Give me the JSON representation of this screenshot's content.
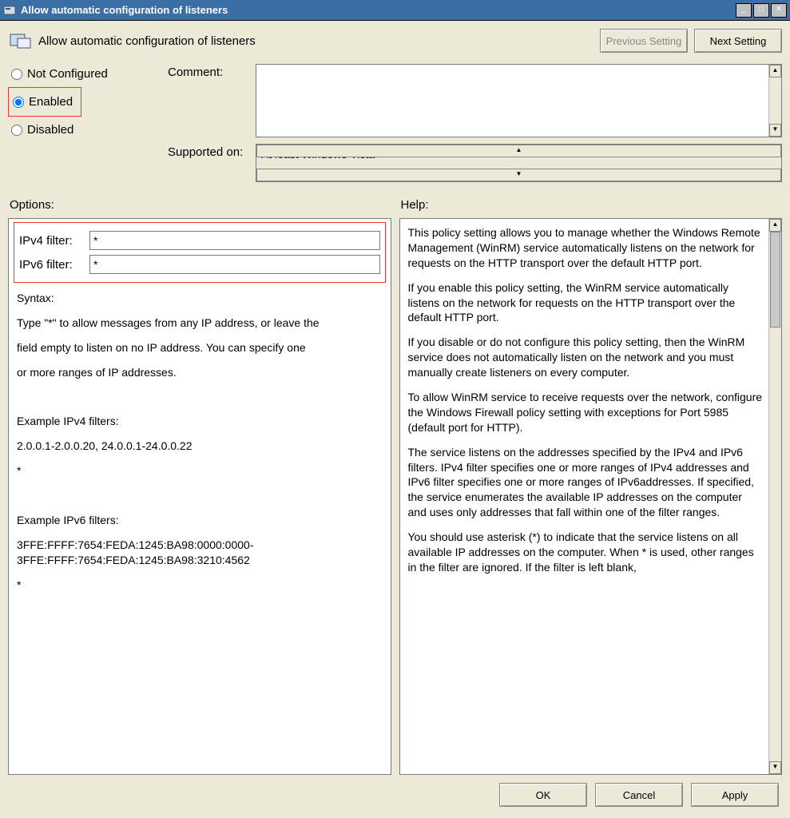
{
  "window": {
    "title": "Allow automatic configuration of listeners"
  },
  "header": {
    "title": "Allow automatic configuration of listeners"
  },
  "nav": {
    "prev": "Previous Setting",
    "next": "Next Setting"
  },
  "radios": {
    "not_configured": "Not Configured",
    "enabled": "Enabled",
    "disabled": "Disabled",
    "selected": "enabled"
  },
  "comment": {
    "label": "Comment:",
    "value": ""
  },
  "supported": {
    "label": "Supported on:",
    "value": "At least Windows Vista"
  },
  "options": {
    "header": "Options:",
    "ipv4_label": "IPv4 filter:",
    "ipv4_value": "*",
    "ipv6_label": "IPv6 filter:",
    "ipv6_value": "*",
    "syntax_head": "Syntax:",
    "syntax_l1": "Type \"*\" to allow messages from any IP address, or leave the",
    "syntax_l2": "field empty to listen on no IP address. You can specify one",
    "syntax_l3": "or more ranges of IP addresses.",
    "ex4_head": "Example IPv4 filters:",
    "ex4_l1": "2.0.0.1-2.0.0.20, 24.0.0.1-24.0.0.22",
    "ex4_l2": "*",
    "ex6_head": "Example IPv6 filters:",
    "ex6_l1": "3FFE:FFFF:7654:FEDA:1245:BA98:0000:0000-3FFE:FFFF:7654:FEDA:1245:BA98:3210:4562",
    "ex6_l2": "*"
  },
  "help": {
    "header": "Help:",
    "p1": "This policy setting allows you to manage whether the Windows Remote Management (WinRM) service automatically listens on the network for requests on the HTTP transport over the default HTTP port.",
    "p2": "If you enable this policy setting, the WinRM service automatically listens on the network for requests on the HTTP transport over the default HTTP port.",
    "p3": "If you disable or do not configure this policy setting, then the WinRM service does not automatically listen on the network and you must manually create listeners on every computer.",
    "p4": "To allow WinRM service to receive requests over the network, configure the Windows Firewall policy setting with exceptions for Port 5985 (default port for HTTP).",
    "p5": "The service listens on the addresses specified by the IPv4 and IPv6 filters. IPv4 filter specifies one or more ranges of IPv4 addresses and IPv6 filter specifies one or more ranges of IPv6addresses. If specified, the service enumerates the available IP addresses on the computer and uses only addresses that fall within one of the filter ranges.",
    "p6": "You should use asterisk (*) to indicate that the service listens on all available IP addresses on the computer. When * is used, other ranges in the filter are ignored. If the filter is left blank,"
  },
  "footer": {
    "ok": "OK",
    "cancel": "Cancel",
    "apply": "Apply"
  }
}
